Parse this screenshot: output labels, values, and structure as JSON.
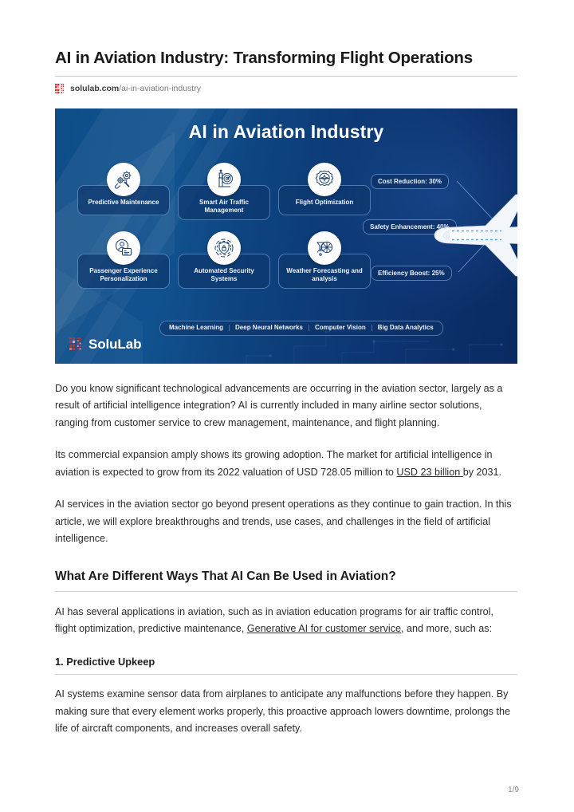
{
  "document": {
    "title": "AI in Aviation Industry: Transforming Flight Operations",
    "source_domain": "solulab.com",
    "source_path": "/ai-in-aviation-industry",
    "favicon_icon": "solulab-pixel-logo-icon",
    "page_indicator": "1/9"
  },
  "hero": {
    "title": "AI in Aviation Industry",
    "brand_name": "SoluLab",
    "brand_mark_icon": "solulab-pixel-logo-icon",
    "airplane_icon": "airplane-top-view-icon",
    "colors": {
      "gradient_start": "#0e4e87",
      "gradient_end": "#0a2a61",
      "card_border": "#96c8ff",
      "text": "#ffffff"
    },
    "cards": [
      {
        "label": "Predictive Maintenance",
        "icon": "gears-wrench-icon"
      },
      {
        "label": "Smart Air Traffic Management",
        "icon": "control-tower-radar-icon"
      },
      {
        "label": "Flight Optimization",
        "icon": "gear-airplane-icon"
      },
      {
        "label": "Passenger Experience Personalization",
        "icon": "passenger-id-card-icon"
      },
      {
        "label": "Automated Security Systems",
        "icon": "shield-lock-icon"
      },
      {
        "label": "Weather Forecasting and analysis",
        "icon": "weather-cloud-icon"
      }
    ],
    "metrics": [
      {
        "label": "Cost Reduction: 30%"
      },
      {
        "label": "Safety Enhancement: 40%"
      },
      {
        "label": "Efficiency Boost: 25%"
      }
    ],
    "tech_tags": [
      "Machine Learning",
      "Deep Neural Networks",
      "Computer Vision",
      "Big Data Analytics"
    ]
  },
  "body": {
    "paragraph_1": "Do you know significant technological advancements are occurring in the aviation sector, largely as a result of artificial intelligence integration? AI is currently included in many airline sector solutions, ranging from customer service to crew management, maintenance, and flight planning.",
    "paragraph_2_before_link": "Its commercial expansion amply shows its growing adoption. The market for artificial intelligence in aviation is expected to grow from its 2022 valuation of USD 728.05 million to ",
    "paragraph_2_link": "USD 23 billion ",
    "paragraph_2_after_link": "by 2031.",
    "paragraph_3": "AI services in the aviation sector go beyond present operations as they continue to gain traction. In this article, we will explore breakthroughs and trends, use cases, and challenges in the field of artificial intelligence.",
    "section_heading": "What Are Different Ways That AI Can Be Used in Aviation?",
    "paragraph_4_before_link": "AI has several applications in aviation, such as in aviation education programs for air traffic control, flight optimization, predictive maintenance, ",
    "paragraph_4_link": "Generative AI for customer service",
    "paragraph_4_after_link": ", and more, such as:",
    "subsection_heading": "1. Predictive Upkeep",
    "paragraph_5": "AI systems examine sensor data from airplanes to anticipate any malfunctions before they happen. By making sure that every element works properly, this proactive approach lowers downtime, prolongs the life of aircraft components, and increases overall safety."
  }
}
